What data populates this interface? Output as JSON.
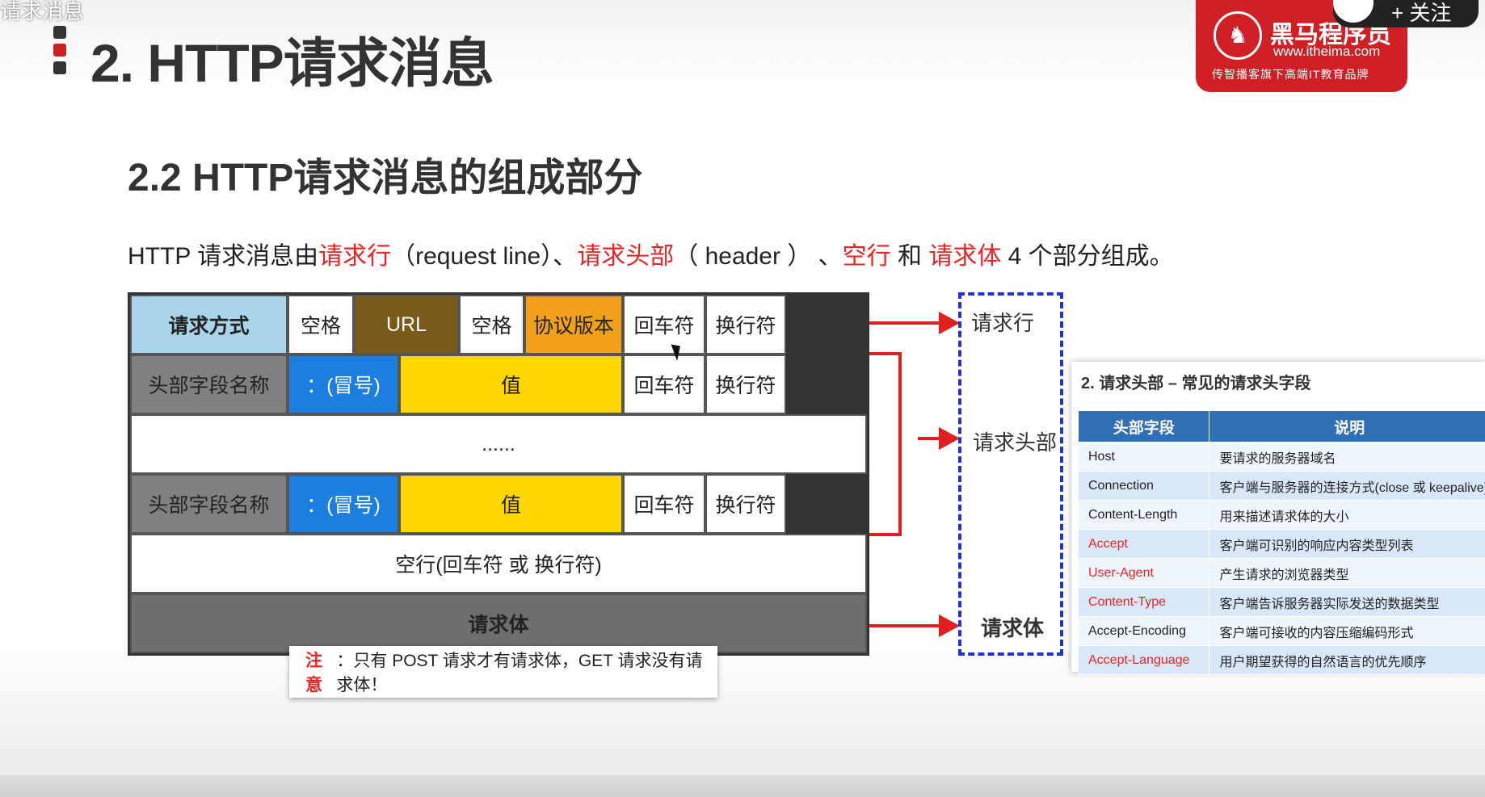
{
  "top_left_text": "请求消息",
  "main_title": "2. HTTP请求消息",
  "logo": {
    "cn": "黑马程序员",
    "url": "www.itheima.com",
    "slogan": "传智播客旗下高端IT教育品牌"
  },
  "follow_button": "+ 关注",
  "sub_title": "2.2 HTTP请求消息的组成部分",
  "desc": {
    "p1": "HTTP 请求消息由",
    "h1": "请求行",
    "p2": "（request line）、",
    "h2": "请求头部",
    "p3": "（ header ） 、",
    "h3": "空行",
    "p4": " 和 ",
    "h4": "请求体",
    "p5": " 4 个部分组成。"
  },
  "grid": {
    "row1": [
      "请求方式",
      "空格",
      "URL",
      "空格",
      "协议版本",
      "回车符",
      "换行符"
    ],
    "row2": [
      "头部字段名称",
      "：(冒号)",
      "值",
      "回车符",
      "换行符"
    ],
    "dots": "......",
    "row4": [
      "头部字段名称",
      "：(冒号)",
      "值",
      "回车符",
      "换行符"
    ],
    "blank": "空行(回车符 或 换行符)",
    "body": "请求体"
  },
  "labels": {
    "line": "请求行",
    "header": "请求头部",
    "body": "请求体"
  },
  "note": {
    "key": "注意",
    "text": "：只有 POST 请求才有请求体，GET 请求没有请求体！"
  },
  "header_table": {
    "title": "2. 请求头部 – 常见的请求头字段",
    "col1": "头部字段",
    "col2": "说明",
    "rows": [
      {
        "field": "Host",
        "desc": "要请求的服务器域名"
      },
      {
        "field": "Connection",
        "desc": "客户端与服务器的连接方式(close 或 keepalive)"
      },
      {
        "field": "Content-Length",
        "desc": "用来描述请求体的大小"
      },
      {
        "field": "Accept",
        "desc": "客户端可识别的响应内容类型列表"
      },
      {
        "field": "User-Agent",
        "desc": "产生请求的浏览器类型"
      },
      {
        "field": "Content-Type",
        "desc": "客户端告诉服务器实际发送的数据类型"
      },
      {
        "field": "Accept-Encoding",
        "desc": "客户端可接收的内容压缩编码形式"
      },
      {
        "field": "Accept-Language",
        "desc": "用户期望获得的自然语言的优先顺序"
      }
    ]
  }
}
